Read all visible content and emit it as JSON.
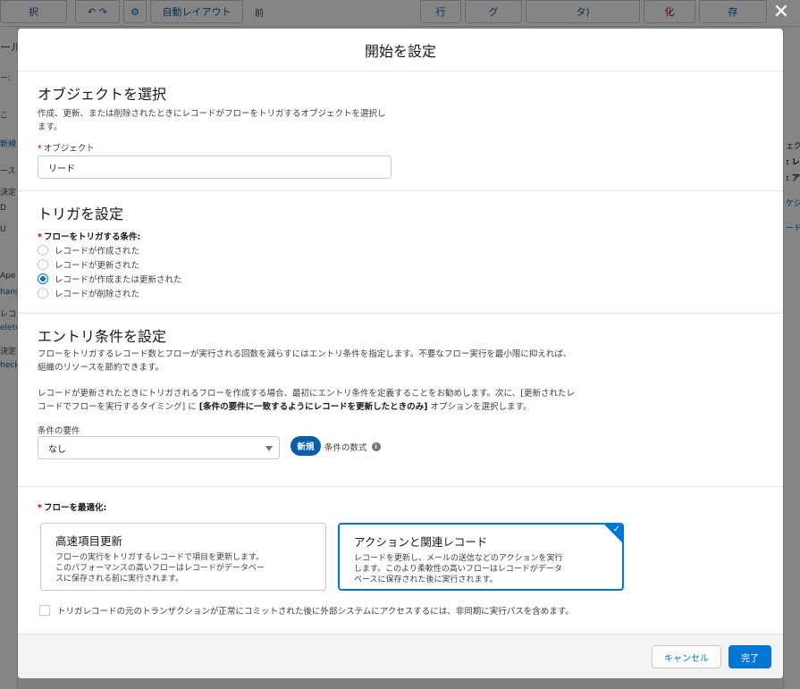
{
  "background": {
    "toolbar_buttons": [
      "択",
      "自動レイアウト",
      "前",
      "行",
      "グ",
      "タ)",
      "化",
      "存"
    ],
    "left_items": [
      "ール",
      "ー:",
      "こ",
      "新規",
      "ース",
      "決定",
      "D",
      "U",
      "Ape",
      "hang",
      "レコ",
      "elete",
      "決定",
      "heck"
    ],
    "right_items": [
      "ェク",
      ": レ",
      ": ア",
      "ケジ",
      "ード"
    ]
  },
  "modal": {
    "title": "開始を設定",
    "close_label": "✕"
  },
  "object_section": {
    "title": "オブジェクトを選択",
    "description_line1": "作成、更新、または削除されたときにレコードがフローをトリガするオブジェクトを選択し",
    "description_line2": "ます。",
    "object_label": "オブジェクト",
    "object_value": "リード"
  },
  "trigger_section": {
    "title": "トリガを設定",
    "condition_label": "フローをトリガする条件:",
    "options": [
      {
        "label": "レコードが作成された",
        "checked": false
      },
      {
        "label": "レコードが更新された",
        "checked": false
      },
      {
        "label": "レコードが作成または更新された",
        "checked": true
      },
      {
        "label": "レコードが削除された",
        "checked": false
      }
    ]
  },
  "entry_section": {
    "title": "エントリ条件を設定",
    "desc1_line1": "フローをトリガするレコード数とフローが実行される回数を減らすにはエントリ条件を指定します。不要なフロー実行を最小限に抑えれば、",
    "desc1_line2": "組織のリソースを節約できます。",
    "desc2_line1": "レコードが更新されたときにトリガされるフローを作成する場合、最初にエントリ条件を定義することをお勧めします。次に、[更新されたレ",
    "desc2_line2_a": "コードでフローを実行するタイミング] に ",
    "desc2_line2_b": "[条件の要件に一致するようにレコードを更新したときのみ]",
    "desc2_line2_c": " オプションを選択します。",
    "requirement_label": "条件の要件",
    "requirement_value": "なし",
    "new_badge": "新規",
    "formula_label": "条件の数式",
    "info_icon": "i"
  },
  "optimize_section": {
    "label": "フローを最適化:",
    "cards": [
      {
        "title": "高速項目更新",
        "desc_line1": "フローの実行をトリガするレコードで項目を更新します。",
        "desc_line2": "このパフォーマンスの高いフローはレコードがデータベー",
        "desc_line3": "スに保存される前に実行されます。",
        "selected": false
      },
      {
        "title": "アクションと関連レコード",
        "desc_line1": "レコードを更新し、メールの送信などのアクションを実行",
        "desc_line2": "します。このより柔軟性の高いフローはレコードがデータ",
        "desc_line3": "ベースに保存された後に実行されます。",
        "selected": true
      }
    ],
    "async_checkbox_label": "トリガレコードの元のトランザクションが正常にコミットされた後に外部システムにアクセスするには、非同期に実行パスを含めます。"
  },
  "footer": {
    "cancel_label": "キャンセル",
    "done_label": "完了"
  },
  "colors": {
    "brand": "#0176d3",
    "badge": "#0b5cab",
    "required": "#ba0517"
  }
}
